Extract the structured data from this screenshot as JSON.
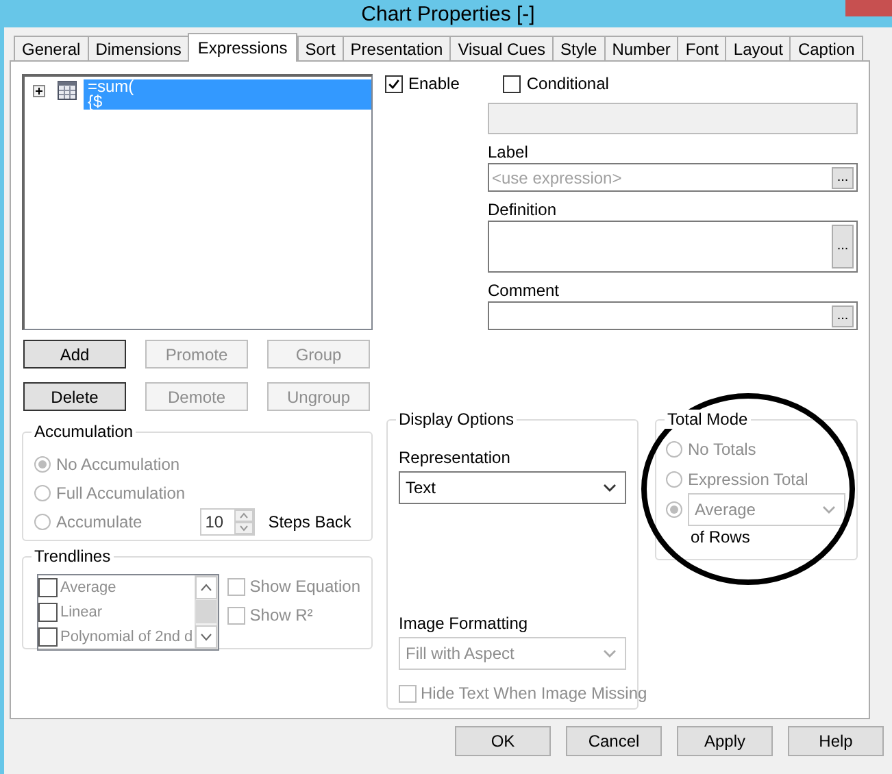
{
  "window": {
    "title": "Chart Properties [-]"
  },
  "tabs": [
    {
      "label": "General",
      "selected": false
    },
    {
      "label": "Dimensions",
      "selected": false
    },
    {
      "label": "Expressions",
      "selected": true
    },
    {
      "label": "Sort",
      "selected": false
    },
    {
      "label": "Presentation",
      "selected": false
    },
    {
      "label": "Visual Cues",
      "selected": false
    },
    {
      "label": "Style",
      "selected": false
    },
    {
      "label": "Number",
      "selected": false
    },
    {
      "label": "Font",
      "selected": false
    },
    {
      "label": "Layout",
      "selected": false
    },
    {
      "label": "Caption",
      "selected": false
    }
  ],
  "expressions": [
    {
      "lines": [
        "=sum(",
        "{$"
      ],
      "selected": true
    }
  ],
  "enable": {
    "label": "Enable",
    "checked": true
  },
  "conditional": {
    "label": "Conditional",
    "checked": false
  },
  "label_field": {
    "label": "Label",
    "placeholder": "<use expression>",
    "button": "..."
  },
  "definition": {
    "label": "Definition",
    "button": "..."
  },
  "comment": {
    "label": "Comment",
    "button": "..."
  },
  "expression_buttons": [
    {
      "label": "Add",
      "disabled": false
    },
    {
      "label": "Promote",
      "disabled": true
    },
    {
      "label": "Group",
      "disabled": true
    },
    {
      "label": "Delete",
      "disabled": false
    },
    {
      "label": "Demote",
      "disabled": true
    },
    {
      "label": "Ungroup",
      "disabled": true
    }
  ],
  "accumulation": {
    "title": "Accumulation",
    "options": [
      {
        "label": "No Accumulation",
        "selected": true
      },
      {
        "label": "Full Accumulation",
        "selected": false
      },
      {
        "label": "Accumulate",
        "selected": false
      }
    ],
    "steps": "10",
    "steps_label": "Steps Back"
  },
  "trendlines": {
    "title": "Trendlines",
    "items": [
      {
        "label": "Average",
        "checked": false
      },
      {
        "label": "Linear",
        "checked": false
      },
      {
        "label": "Polynomial of 2nd d",
        "checked": false
      }
    ],
    "options": [
      {
        "label": "Show Equation",
        "checked": false
      },
      {
        "label": "Show R²",
        "checked": false
      }
    ]
  },
  "display_options": {
    "title": "Display Options",
    "representation": {
      "label": "Representation",
      "value": "Text"
    },
    "image_formatting": {
      "label": "Image Formatting",
      "value": "Fill with Aspect",
      "disabled": true
    },
    "hide_text": {
      "label": "Hide Text When Image Missing",
      "checked": false
    }
  },
  "total_mode": {
    "title": "Total Mode",
    "options": [
      {
        "kind": "radio",
        "label": "No Totals",
        "selected": false
      },
      {
        "kind": "radio",
        "label": "Expression Total",
        "selected": false
      },
      {
        "kind": "aggregate",
        "value": "Average",
        "selected": true
      }
    ],
    "suffix": "of Rows"
  },
  "dialog_buttons": [
    "OK",
    "Cancel",
    "Apply",
    "Help"
  ]
}
